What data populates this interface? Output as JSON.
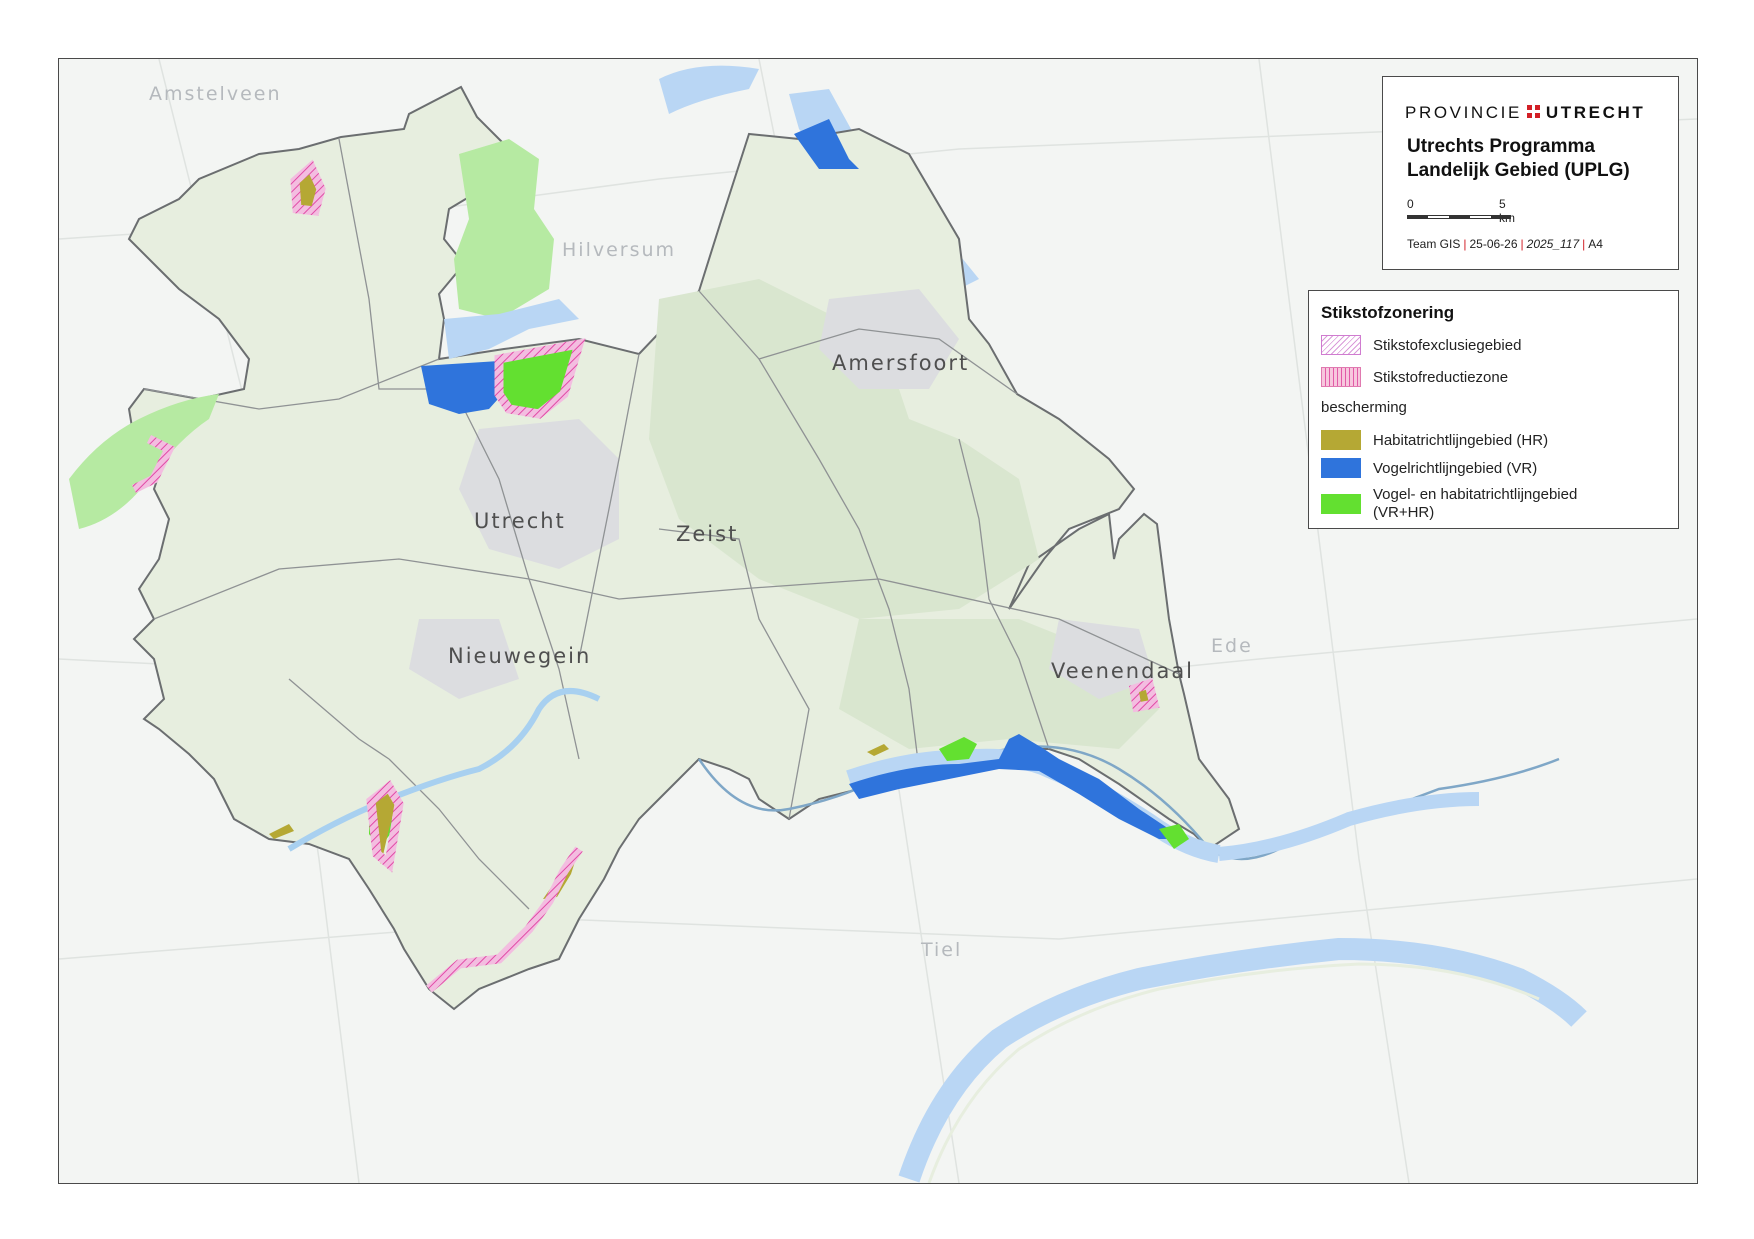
{
  "places": {
    "amstelveen": "Amstelveen",
    "hilversum": "Hilversum",
    "amersfoort": "Amersfoort",
    "utrecht": "Utrecht",
    "zeist": "Zeist",
    "nieuwegein": "Nieuwegein",
    "veenendaal": "Veenendaal",
    "ede": "Ede",
    "tiel": "Tiel"
  },
  "title_box": {
    "org_left": "PROVINCIE",
    "org_right": "UTRECHT",
    "title": "Utrechts Programma Landelijk Gebied (UPLG)",
    "scale_start": "0",
    "scale_end": "5 km",
    "credit_team": "Team GIS",
    "credit_date": "25-06-26",
    "credit_code": "2025_117",
    "credit_format": "A4",
    "separator": "|"
  },
  "legend": {
    "title": "Stikstofzonering",
    "items": [
      {
        "label": "Stikstofexclusiegebied"
      },
      {
        "label": "Stikstofreductiezone"
      }
    ],
    "subheading": "bescherming",
    "protection": [
      {
        "label": "Habitatrichtlijngebied (HR)"
      },
      {
        "label": "Vogelrichtlijngebied (VR)"
      },
      {
        "label": "Vogel- en habitatrichtlijngebied (VR+HR)"
      }
    ]
  },
  "colors": {
    "province_fill": "#e7eedf",
    "water": "#b9d6f4",
    "hr": "#b5a834",
    "vr": "#2f74dc",
    "vrhr": "#63e030",
    "reduction_zone": "#e98fc4",
    "exclusion_zone": "#d99ad9",
    "brand_red": "#d21f26"
  }
}
